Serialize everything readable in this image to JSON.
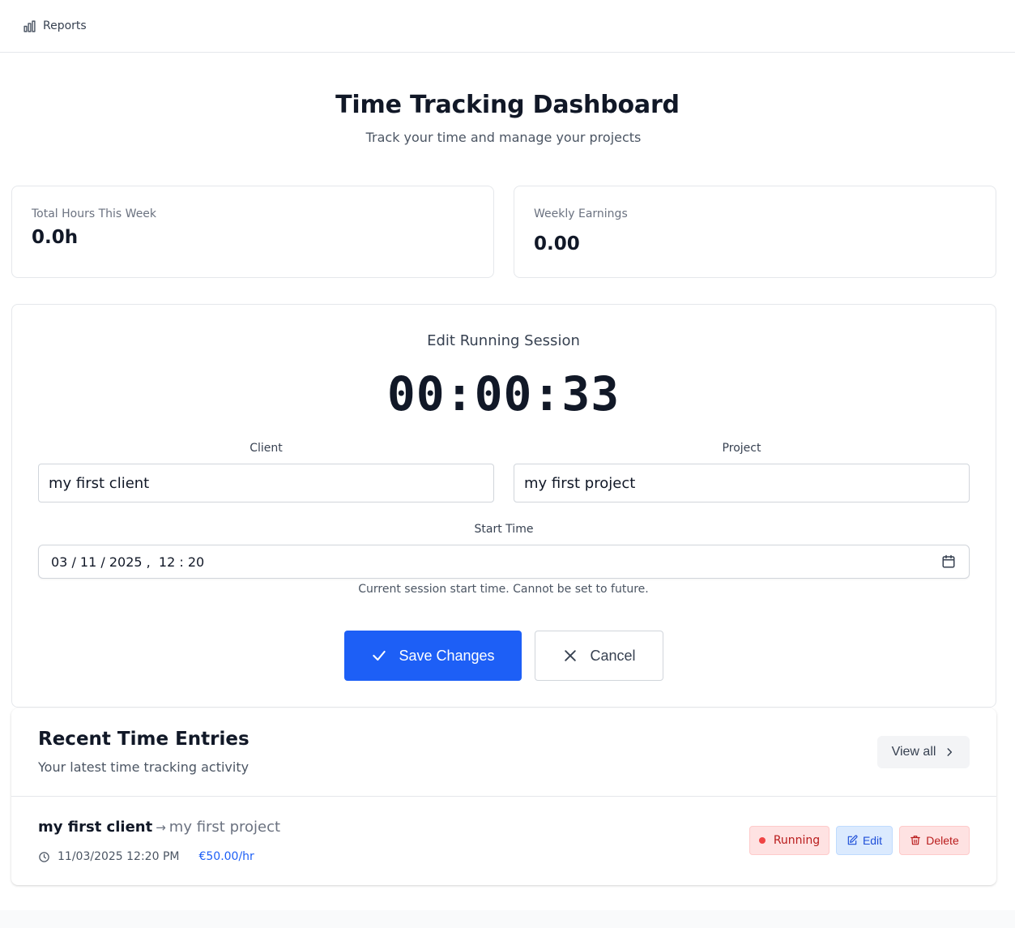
{
  "nav": {
    "reports_label": "Reports",
    "reports_icon": "bar-chart-icon"
  },
  "header": {
    "title": "Time Tracking Dashboard",
    "subtitle": "Track your time and manage your projects"
  },
  "stats": {
    "total_hours_label": "Total Hours This Week",
    "total_hours_value": "0.0h",
    "weekly_earnings_label": "Weekly Earnings",
    "weekly_earnings_value": "0.00"
  },
  "session": {
    "title": "Edit Running Session",
    "timer": "00:00:33",
    "client_label": "Client",
    "client_value": "my first client",
    "project_label": "Project",
    "project_value": "my first project",
    "start_time_label": "Start Time",
    "start_time_value": "03 / 11 / 2025 ,  12 : 20",
    "start_time_help": "Current session start time. Cannot be set to future.",
    "save_label": "Save Changes",
    "cancel_label": "Cancel"
  },
  "recent": {
    "title": "Recent Time Entries",
    "subtitle": "Your latest time tracking activity",
    "view_all_label": "View all",
    "entries": [
      {
        "client": "my first client",
        "project": "my first project",
        "datetime": "11/03/2025 12:20 PM",
        "rate": "€50.00/hr",
        "status": "Running",
        "edit_label": "Edit",
        "delete_label": "Delete"
      }
    ]
  },
  "colors": {
    "primary": "#1d5ff6",
    "running_bg": "#fee2e2",
    "edit_bg": "#dbeafe"
  }
}
